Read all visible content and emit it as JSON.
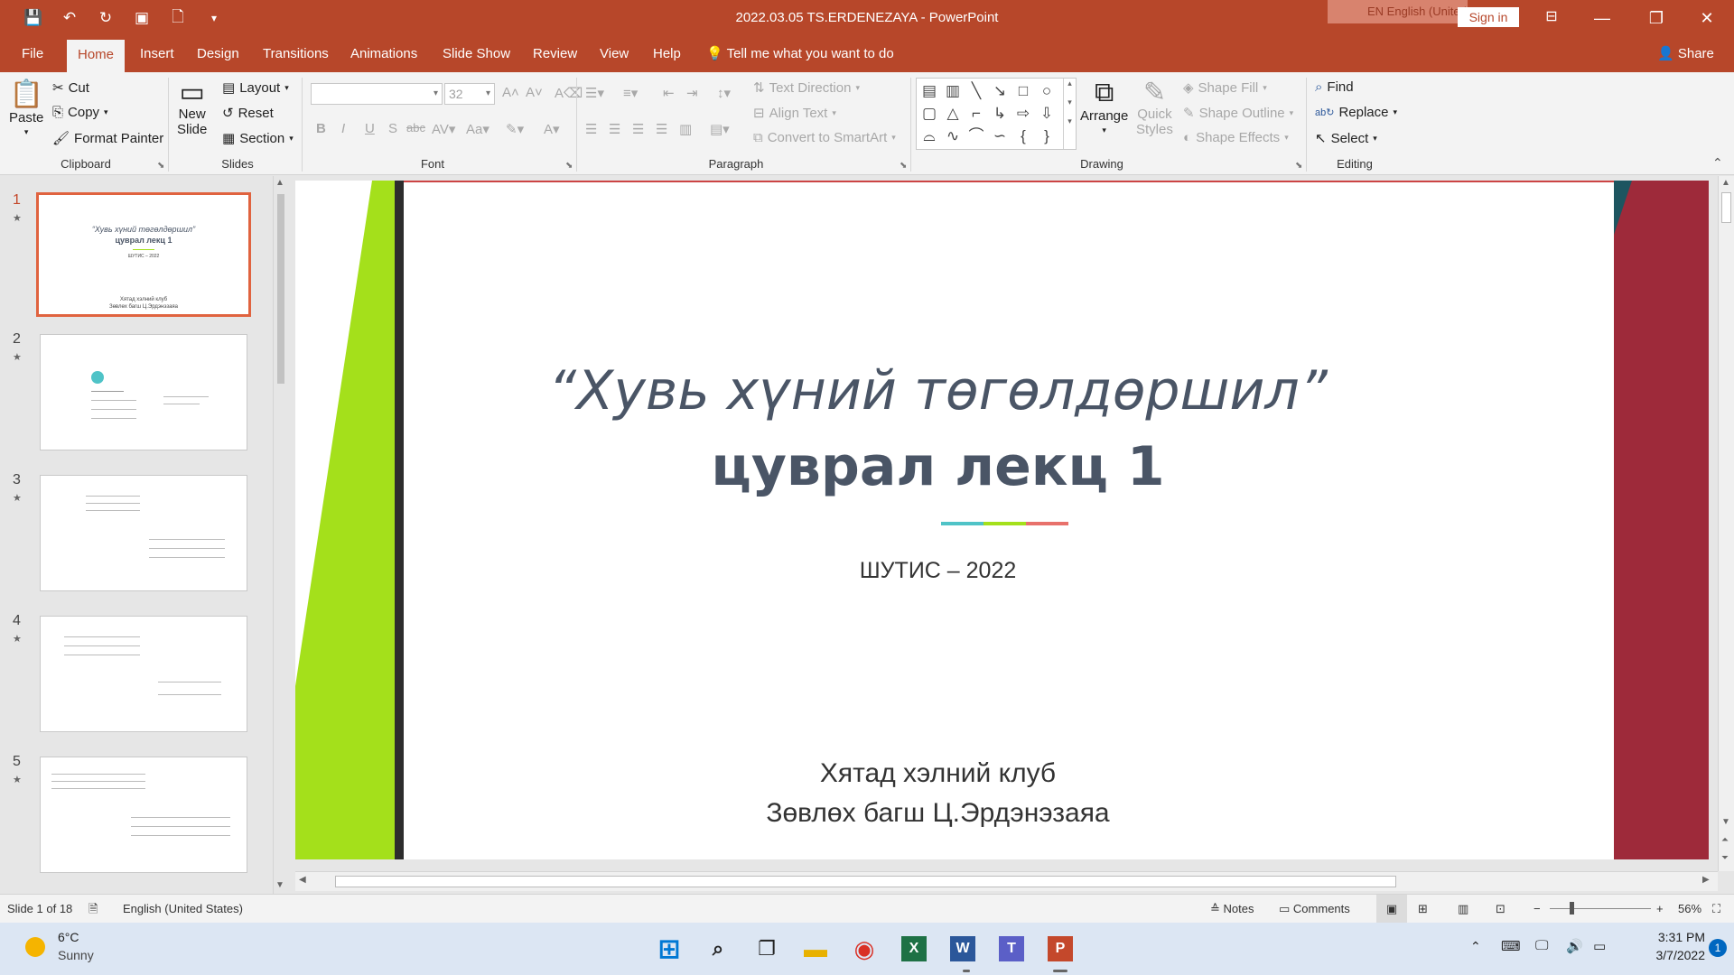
{
  "window": {
    "title": "2022.03.05 TS.ERDENEZAYA  -  PowerPoint",
    "lang_indicator": "EN English (United States)",
    "sign_in": "Sign in",
    "minimize": "—",
    "maximize": "❐",
    "close": "✕"
  },
  "qat": {
    "save_icon": "💾",
    "undo_icon": "↶",
    "redo_icon": "↻",
    "present_icon": "▣",
    "new_icon": "🗋",
    "more_icon": "▾"
  },
  "tabs": [
    "File",
    "Home",
    "Insert",
    "Design",
    "Transitions",
    "Animations",
    "Slide Show",
    "Review",
    "View",
    "Help"
  ],
  "tell_me": "Tell me what you want to do",
  "share": "Share",
  "ribbon": {
    "clipboard": {
      "paste": "Paste",
      "cut": "Cut",
      "copy": "Copy",
      "format_painter": "Format Painter",
      "label": "Clipboard"
    },
    "slides": {
      "new_slide_1": "New",
      "new_slide_2": "Slide",
      "layout": "Layout",
      "reset": "Reset",
      "section": "Section",
      "label": "Slides"
    },
    "font": {
      "font_size": "32",
      "label": "Font"
    },
    "paragraph": {
      "text_direction": "Text Direction",
      "align_text": "Align Text",
      "convert_smartart": "Convert to SmartArt",
      "label": "Paragraph"
    },
    "drawing": {
      "arrange": "Arrange",
      "quick_1": "Quick",
      "quick_2": "Styles",
      "shape_fill": "Shape Fill",
      "shape_outline": "Shape Outline",
      "shape_effects": "Shape Effects",
      "label": "Drawing"
    },
    "editing": {
      "find": "Find",
      "replace": "Replace",
      "select": "Select",
      "label": "Editing"
    }
  },
  "thumbnails": [
    {
      "num": "1",
      "star": "★",
      "l1": "“Хувь хүний төгөлдөршил”",
      "l2": "цуврал лекц 1",
      "l3": "ШУТИС – 2022",
      "l4": "Хятад хэлний клуб",
      "l5": "Зөвлөх багш Ц.Эрдэнэзаяа"
    },
    {
      "num": "2",
      "star": "★"
    },
    {
      "num": "3",
      "star": "★"
    },
    {
      "num": "4",
      "star": "★"
    },
    {
      "num": "5",
      "star": "★"
    }
  ],
  "slide": {
    "title_line1": "“Хувь хүний төгөлдөршил”",
    "title_line2": "цуврал лекц 1",
    "subtitle": "ШУТИС – 2022",
    "author_line1": "Хятад хэлний клуб",
    "author_line2": "Зөвлөх багш Ц.Эрдэнэзаяа",
    "underline_colors": [
      "#4fc3c7",
      "#a4e01b",
      "#e8716b"
    ]
  },
  "statusbar": {
    "slide_info": "Slide 1 of 18",
    "language": "English (United States)",
    "notes": "Notes",
    "comments": "Comments",
    "zoom": "56%"
  },
  "taskbar": {
    "temp": "6°C",
    "weather": "Sunny",
    "time": "3:31 PM",
    "date": "3/7/2022",
    "notification_count": "1"
  },
  "colors": {
    "accent": "#b7472a",
    "slide_green": "#a4e01b",
    "slide_red": "#9e2a3a",
    "slide_dark": "#2d2d2d"
  }
}
